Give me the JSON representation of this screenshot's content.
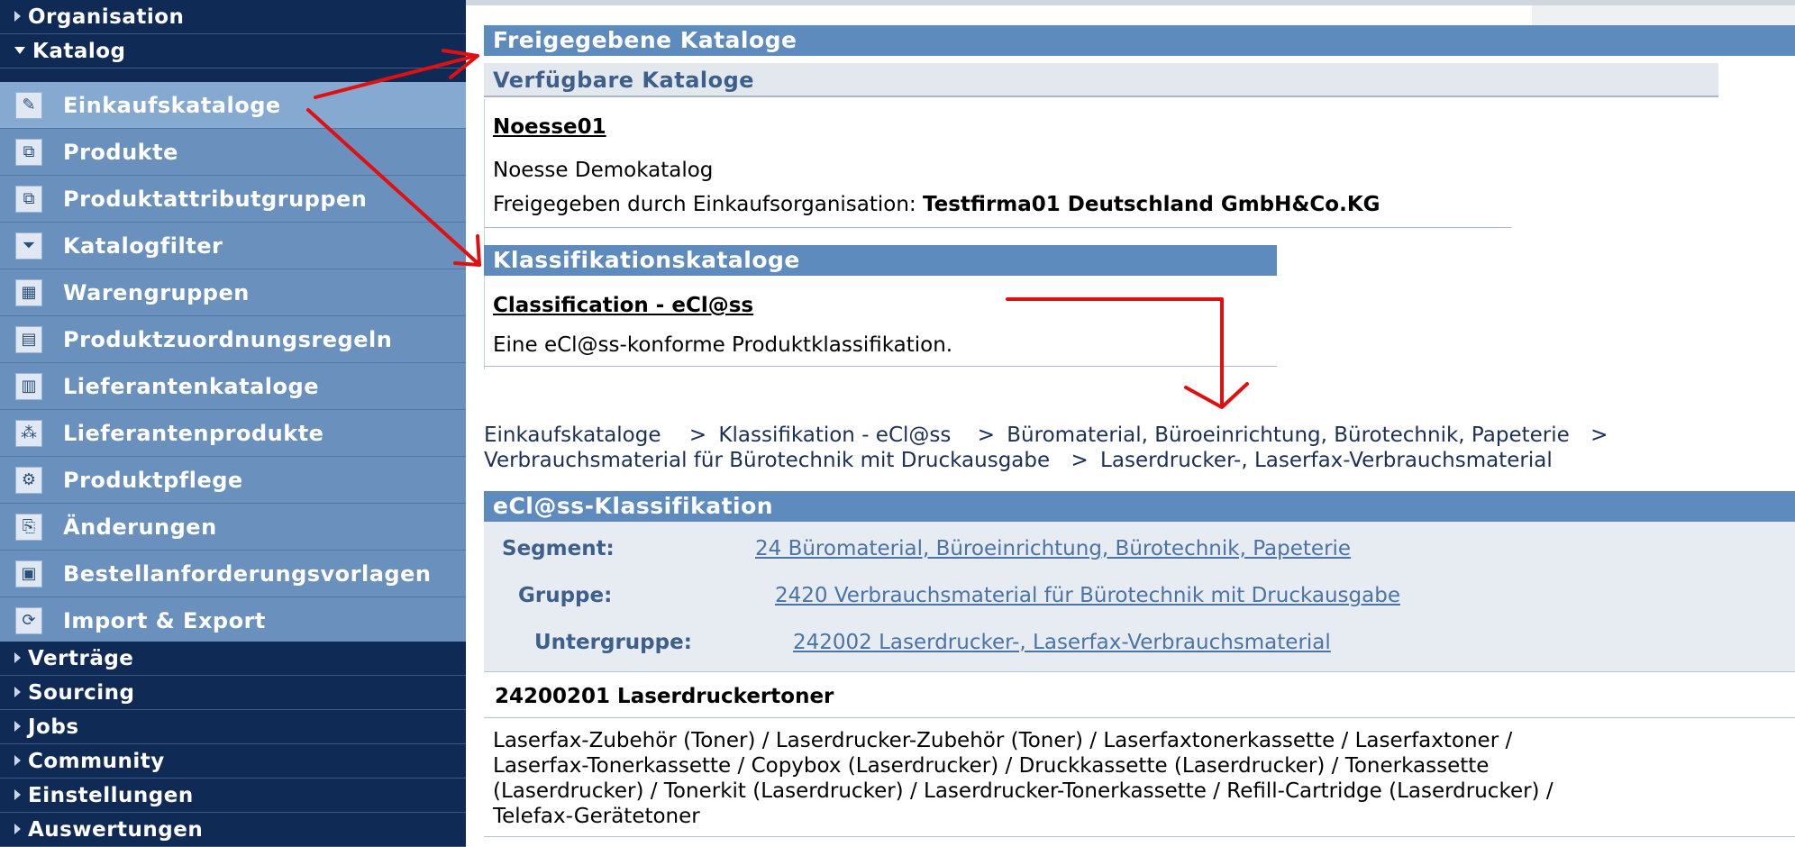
{
  "sidebar": {
    "sections_top": [
      {
        "label": "Organisation",
        "expanded": false
      },
      {
        "label": "Katalog",
        "expanded": true
      }
    ],
    "items": [
      {
        "label": "Einkaufskataloge",
        "icon": "pencil-icon",
        "glyph": "✎",
        "selected": true
      },
      {
        "label": "Produkte",
        "icon": "cubes-icon",
        "glyph": "⧉"
      },
      {
        "label": "Produktattributgruppen",
        "icon": "cubes-icon",
        "glyph": "⧉"
      },
      {
        "label": "Katalogfilter",
        "icon": "filter-icon",
        "glyph": "⏷"
      },
      {
        "label": "Warengruppen",
        "icon": "grid-icon",
        "glyph": "▦"
      },
      {
        "label": "Produktzuordnungsregeln",
        "icon": "rules-icon",
        "glyph": "▤"
      },
      {
        "label": "Lieferantenkataloge",
        "icon": "catalog-icon",
        "glyph": "▥"
      },
      {
        "label": "Lieferantenprodukte",
        "icon": "boxes-icon",
        "glyph": "⁂"
      },
      {
        "label": "Produktpflege",
        "icon": "maintenance-icon",
        "glyph": "⚙"
      },
      {
        "label": "Änderungen",
        "icon": "changes-icon",
        "glyph": "⎘"
      },
      {
        "label": "Bestellanforderungsvorlagen",
        "icon": "template-icon",
        "glyph": "▣"
      },
      {
        "label": "Import & Export",
        "icon": "sync-icon",
        "glyph": "⟳"
      }
    ],
    "sections_bottom": [
      {
        "label": "Verträge"
      },
      {
        "label": "Sourcing"
      },
      {
        "label": "Jobs"
      },
      {
        "label": "Community"
      },
      {
        "label": "Einstellungen"
      },
      {
        "label": "Auswertungen"
      }
    ]
  },
  "main": {
    "released_title": "Freigegebene Kataloge",
    "available_title": "Verfügbare Kataloge",
    "catalog": {
      "name": "Noesse01",
      "description": "Noesse Demokatalog",
      "released_by_label": "Freigegeben durch Einkaufsorganisation: ",
      "released_by_org": "Testfirma01 Deutschland GmbH&Co.KG"
    },
    "classification_title": "Klassifikationskataloge",
    "classification": {
      "name": "Classification - eCl@ss",
      "description": "Eine eCl@ss-konforme Produktklassifikation."
    },
    "breadcrumb": {
      "items": [
        "Einkaufskataloge",
        "Klassifikation - eCl@ss",
        "Büromaterial, Büroeinrichtung, Bürotechnik, Papeterie",
        "Verbrauchsmaterial für Bürotechnik mit Druckausgabe",
        "Laserdrucker-, Laserfax-Verbrauchsmaterial"
      ],
      "separator": ">"
    },
    "ecl": {
      "title": "eCl@ss-Klassifikation",
      "segment_label": "Segment:",
      "segment_value": "24 Büromaterial, Büroeinrichtung, Bürotechnik, Papeterie",
      "group_label": "Gruppe:",
      "group_value": "2420 Verbrauchsmaterial für Bürotechnik mit Druckausgabe",
      "subgroup_label": "Untergruppe:",
      "subgroup_value": "242002 Laserdrucker-, Laserfax-Verbrauchsmaterial"
    },
    "class_entry": {
      "title": "24200201 Laserdruckertoner",
      "keywords": [
        "Laserfax-Zubehör (Toner) / Laserdrucker-Zubehör (Toner) / Laserfaxtonerkassette / Laserfaxtoner /",
        "Laserfax-Tonerkassette / Copybox (Laserdrucker) / Druckkassette (Laserdrucker) / Tonerkassette",
        "(Laserdrucker) / Tonerkit (Laserdrucker) / Laserdrucker-Tonerkassette / Refill-Cartridge (Laserdrucker) /",
        "Telefax-Gerätetoner"
      ]
    }
  },
  "colors": {
    "sidebar_dark": "#0f2a55",
    "sidebar_item": "#6a91bd",
    "header_blue": "#5e8bbd",
    "annotation_red": "#e01010"
  }
}
